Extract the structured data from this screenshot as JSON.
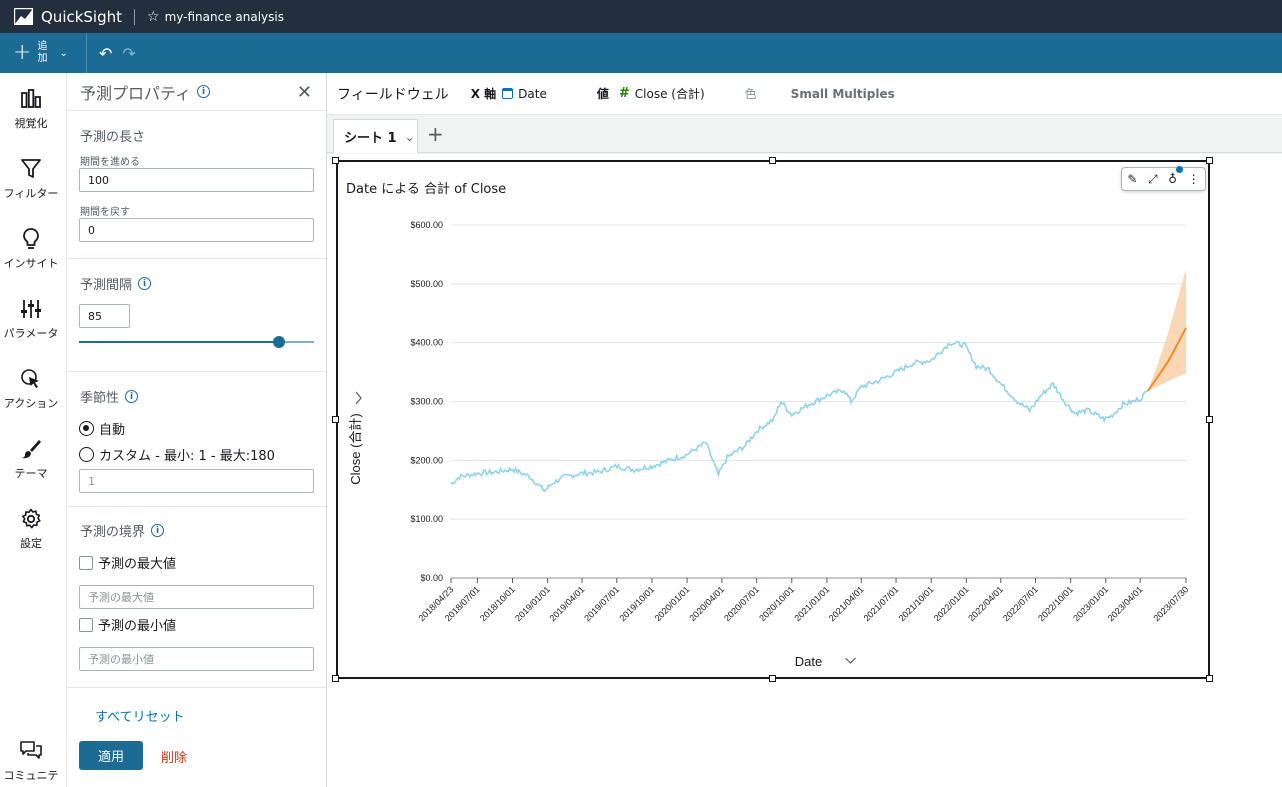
{
  "app": {
    "brand": "QuickSight",
    "analysis_name": "my-finance analysis"
  },
  "toolbar": {
    "add_label": "追加"
  },
  "rail": {
    "items": [
      {
        "label": "視覚化",
        "icon": "bar-chart-icon"
      },
      {
        "label": "フィルター",
        "icon": "filter-icon"
      },
      {
        "label": "インサイト",
        "icon": "lightbulb-icon"
      },
      {
        "label": "パラメータ",
        "icon": "sliders-icon"
      },
      {
        "label": "アクション",
        "icon": "cursor-click-icon"
      },
      {
        "label": "テーマ",
        "icon": "brush-icon"
      },
      {
        "label": "設定",
        "icon": "gear-icon"
      }
    ],
    "community": {
      "label": "コミュニテ",
      "icon": "chat-icon"
    }
  },
  "props": {
    "title": "予測プロパティ",
    "length": {
      "title": "予測の長さ",
      "forward_label": "期間を進める",
      "forward_value": "100",
      "backward_label": "期間を戻す",
      "backward_value": "0"
    },
    "interval": {
      "title": "予測間隔",
      "value": "85",
      "slider_level": 0.85
    },
    "seasonality": {
      "title": "季節性",
      "auto_label": "自動",
      "custom_label": "カスタム - 最小: 1 - 最大:180",
      "custom_placeholder": "1"
    },
    "bounds": {
      "title": "予測の境界",
      "max_label": "予測の最大値",
      "max_placeholder": "予測の最大値",
      "min_label": "予測の最小値",
      "min_placeholder": "予測の最小値"
    },
    "reset_all": "すべてリセット",
    "apply": "適用",
    "delete": "削除"
  },
  "fieldwell": {
    "title": "フィールドウェル",
    "x_key": "X 軸",
    "x_value": "Date",
    "value_key": "値",
    "value_value": "Close (合計)",
    "color_key": "色",
    "small_multiples": "Small Multiples"
  },
  "sheet": {
    "tab_label": "シート 1"
  },
  "colors": {
    "series": "#8fd3e8",
    "forecast": "#f08c28",
    "band": "#fbd0a8",
    "accent": "#1b6b95"
  },
  "chart_data": {
    "type": "line",
    "title": "Date による 合計 of Close",
    "xlabel": "Date",
    "ylabel": "Close (合計)",
    "ylim": [
      0,
      600
    ],
    "y_ticks": [
      "$0.00",
      "$100.00",
      "$200.00",
      "$300.00",
      "$400.00",
      "$500.00",
      "$600.00"
    ],
    "y_tick_values": [
      0,
      100,
      200,
      300,
      400,
      500,
      600
    ],
    "x_ticks": [
      "2018/04/23",
      "2018/07/01",
      "2018/10/01",
      "2019/01/01",
      "2019/04/01",
      "2019/07/01",
      "2019/10/01",
      "2020/01/01",
      "2020/04/01",
      "2020/07/01",
      "2020/10/01",
      "2021/01/01",
      "2021/04/01",
      "2021/07/01",
      "2021/10/01",
      "2022/01/01",
      "2022/04/01",
      "2022/07/01",
      "2022/10/01",
      "2023/01/01",
      "2023/04/01",
      "2023/07/30"
    ],
    "grid": true,
    "series": [
      {
        "x": [
          "2018/04/23",
          "2018/05/15",
          "2018/07/01",
          "2018/08/15",
          "2018/10/01",
          "2018/11/15",
          "2018/12/24",
          "2019/01/15",
          "2019/02/15",
          "2019/04/01",
          "2019/05/15",
          "2019/07/01",
          "2019/08/15",
          "2019/10/01",
          "2019/11/15",
          "2020/01/01",
          "2020/02/19",
          "2020/03/23",
          "2020/04/15",
          "2020/06/01",
          "2020/07/01",
          "2020/08/15",
          "2020/09/02",
          "2020/10/01",
          "2020/11/15",
          "2021/01/01",
          "2021/02/15",
          "2021/03/05",
          "2021/04/01",
          "2021/05/15",
          "2021/07/01",
          "2021/08/15",
          "2021/10/01",
          "2021/11/19",
          "2021/12/28",
          "2022/01/27",
          "2022/03/01",
          "2022/04/01",
          "2022/05/15",
          "2022/06/16",
          "2022/07/15",
          "2022/08/16",
          "2022/09/15",
          "2022/10/12",
          "2022/11/15",
          "2022/12/28",
          "2023/01/15",
          "2023/02/15",
          "2023/03/15",
          "2023/04/01",
          "2023/04/21"
        ],
        "values": [
          160,
          172,
          178,
          180,
          185,
          172,
          148,
          162,
          172,
          178,
          180,
          190,
          184,
          190,
          200,
          210,
          230,
          175,
          205,
          225,
          250,
          270,
          300,
          278,
          295,
          310,
          320,
          300,
          325,
          335,
          350,
          365,
          370,
          400,
          396,
          360,
          355,
          330,
          300,
          285,
          310,
          330,
          300,
          280,
          285,
          270,
          275,
          295,
          300,
          305,
          318
        ]
      },
      {
        "name": "Forecast",
        "x": [
          "2023/04/21",
          "2023/05/15",
          "2023/06/15",
          "2023/07/30"
        ],
        "values": [
          318,
          340,
          370,
          425
        ],
        "lower": [
          318,
          325,
          335,
          348
        ],
        "upper": [
          318,
          360,
          420,
          525
        ]
      }
    ]
  }
}
